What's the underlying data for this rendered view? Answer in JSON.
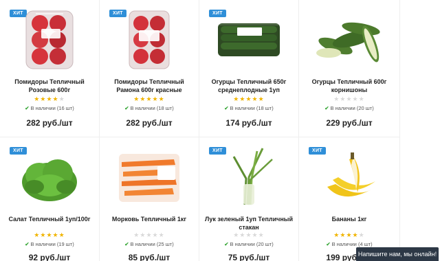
{
  "badge_label": "ХИТ",
  "products": [
    {
      "title": "Помидоры Тепличный Розовые 600г",
      "rating": 4,
      "stock": "В наличии (16 шт)",
      "price": "282 руб./шт",
      "hit": true,
      "image": "tomato-pack-image"
    },
    {
      "title": "Помидоры Тепличный Рамона 600г красные",
      "rating": 5,
      "stock": "В наличии (18 шт)",
      "price": "282 руб./шт",
      "hit": true,
      "image": "tomato-tray-image"
    },
    {
      "title": "Огурцы Тепличный 650г среднеплодные 1уп",
      "rating": 5,
      "stock": "В наличии (18 шт)",
      "price": "174 руб./шт",
      "hit": true,
      "image": "cucumber-pack-image"
    },
    {
      "title": "Огурцы Тепличный 600г корнишоны",
      "rating": 0,
      "stock": "В наличии (20 шт)",
      "price": "229 руб./шт",
      "hit": false,
      "image": "gherkin-image"
    },
    {
      "title": "Салат Тепличный 1уп/100г",
      "rating": 5,
      "stock": "В наличии (19 шт)",
      "price": "92 руб./шт",
      "hit": true,
      "image": "lettuce-image"
    },
    {
      "title": "Морковь Тепличный 1кг",
      "rating": 0,
      "stock": "В наличии (25 шт)",
      "price": "85 руб./шт",
      "hit": false,
      "image": "carrot-bag-image"
    },
    {
      "title": "Лук зеленый 1уп Тепличный стакан",
      "rating": 0,
      "stock": "В наличии (20 шт)",
      "price": "75 руб./шт",
      "hit": true,
      "image": "green-onion-image"
    },
    {
      "title": "Бананы 1кг",
      "rating": 4,
      "stock": "В наличии (4 шт)",
      "price": "199 руб./шт",
      "hit": true,
      "image": "banana-image"
    }
  ],
  "chat_label": "Напишите нам, мы онлайн!",
  "colors": {
    "badge": "#2f8fd8",
    "star_on": "#f0b400",
    "star_off": "#d9d9d9",
    "check": "#3aa83a",
    "chat_bg": "#2d3846"
  }
}
